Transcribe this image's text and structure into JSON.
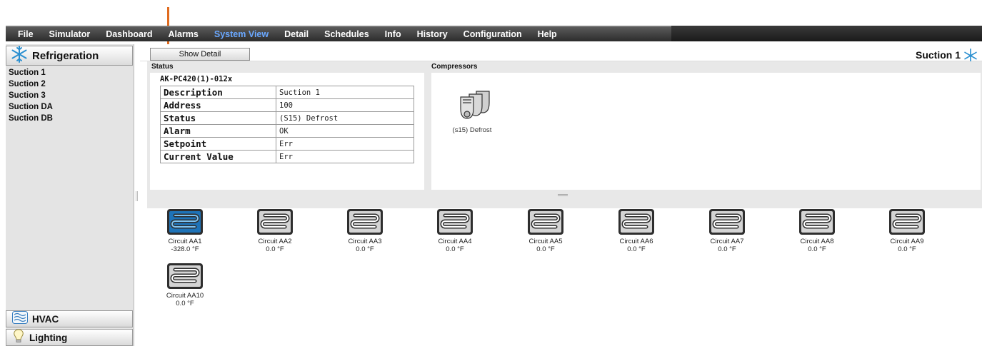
{
  "menu": {
    "items": [
      {
        "label": "File",
        "active": false
      },
      {
        "label": "Simulator",
        "active": false
      },
      {
        "label": "Dashboard",
        "active": false
      },
      {
        "label": "Alarms",
        "active": false
      },
      {
        "label": "System View",
        "active": true
      },
      {
        "label": "Detail",
        "active": false
      },
      {
        "label": "Schedules",
        "active": false
      },
      {
        "label": "Info",
        "active": false
      },
      {
        "label": "History",
        "active": false
      },
      {
        "label": "Configuration",
        "active": false
      },
      {
        "label": "Help",
        "active": false
      }
    ]
  },
  "sidebar": {
    "header": "Refrigeration",
    "items": [
      "Suction 1",
      "Suction 2",
      "Suction 3",
      "Suction DA",
      "Suction DB"
    ],
    "sections": [
      "HVAC",
      "Lighting"
    ]
  },
  "toolbar": {
    "show_detail_label": "Show Detail",
    "title": "Suction 1"
  },
  "status": {
    "label": "Status",
    "device": "AK-PC420(1)-012x",
    "rows": [
      {
        "key": "Description",
        "value": "Suction 1"
      },
      {
        "key": "Address",
        "value": "100"
      },
      {
        "key": "Status",
        "value": "(S15) Defrost"
      },
      {
        "key": "Alarm",
        "value": "OK"
      },
      {
        "key": "Setpoint",
        "value": "Err"
      },
      {
        "key": "Current Value",
        "value": "Err"
      }
    ]
  },
  "compressors": {
    "label": "Compressors",
    "state": "(s15) Defrost"
  },
  "circuits": [
    {
      "name": "Circuit AA1",
      "temp": "-328.0 °F",
      "active": true
    },
    {
      "name": "Circuit AA2",
      "temp": "0.0 °F",
      "active": false
    },
    {
      "name": "Circuit AA3",
      "temp": "0.0 °F",
      "active": false
    },
    {
      "name": "Circuit AA4",
      "temp": "0.0 °F",
      "active": false
    },
    {
      "name": "Circuit AA5",
      "temp": "0.0 °F",
      "active": false
    },
    {
      "name": "Circuit AA6",
      "temp": "0.0 °F",
      "active": false
    },
    {
      "name": "Circuit AA7",
      "temp": "0.0 °F",
      "active": false
    },
    {
      "name": "Circuit AA8",
      "temp": "0.0 °F",
      "active": false
    },
    {
      "name": "Circuit AA9",
      "temp": "0.0 °F",
      "active": false
    },
    {
      "name": "Circuit AA10",
      "temp": "0.0 °F",
      "active": false
    }
  ],
  "colors": {
    "active_menu": "#6aa8ff",
    "circuit_active": "#1e73b8",
    "annotation": "#e06b1f"
  },
  "icons": {
    "sidebar_header": "snowflake-icon",
    "hvac": "air-waves-icon",
    "lighting": "lightbulb-icon",
    "compressor": "compressor-icon",
    "circuit": "evaporator-coil-icon"
  }
}
